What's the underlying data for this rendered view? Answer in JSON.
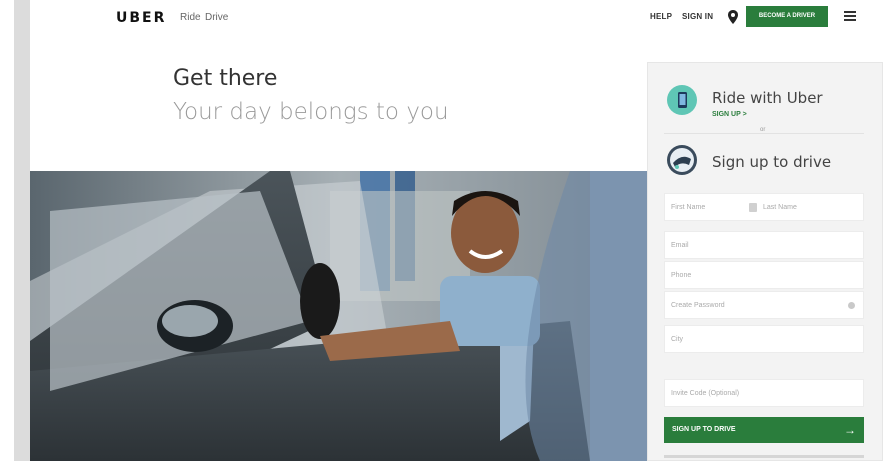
{
  "header": {
    "logo": "UBER",
    "nav": [
      "Ride",
      "Drive"
    ],
    "help": "HELP",
    "sign_in": "SIGN IN",
    "become_driver": "BECOME A DRIVER",
    "icons": [
      "location-pin-icon",
      "hamburger-menu-icon"
    ]
  },
  "hero": {
    "title": "Get there",
    "subtitle": "Your day belongs to you"
  },
  "panel": {
    "ride_title": "Ride with Uber",
    "ride_signup": "SIGN UP  >",
    "or": "or",
    "drive_title": "Sign up to drive",
    "fields": {
      "first_name": "First Name",
      "last_name": "Last Name",
      "email": "Email",
      "phone": "Phone",
      "password": "Create Password",
      "city": "City",
      "invite": "Invite Code (Optional)"
    },
    "submit": "SIGN UP TO DRIVE",
    "submit_arrow": "→"
  },
  "colors": {
    "brand_green": "#2a7d3c",
    "ride_icon": "#5fc6b5"
  }
}
